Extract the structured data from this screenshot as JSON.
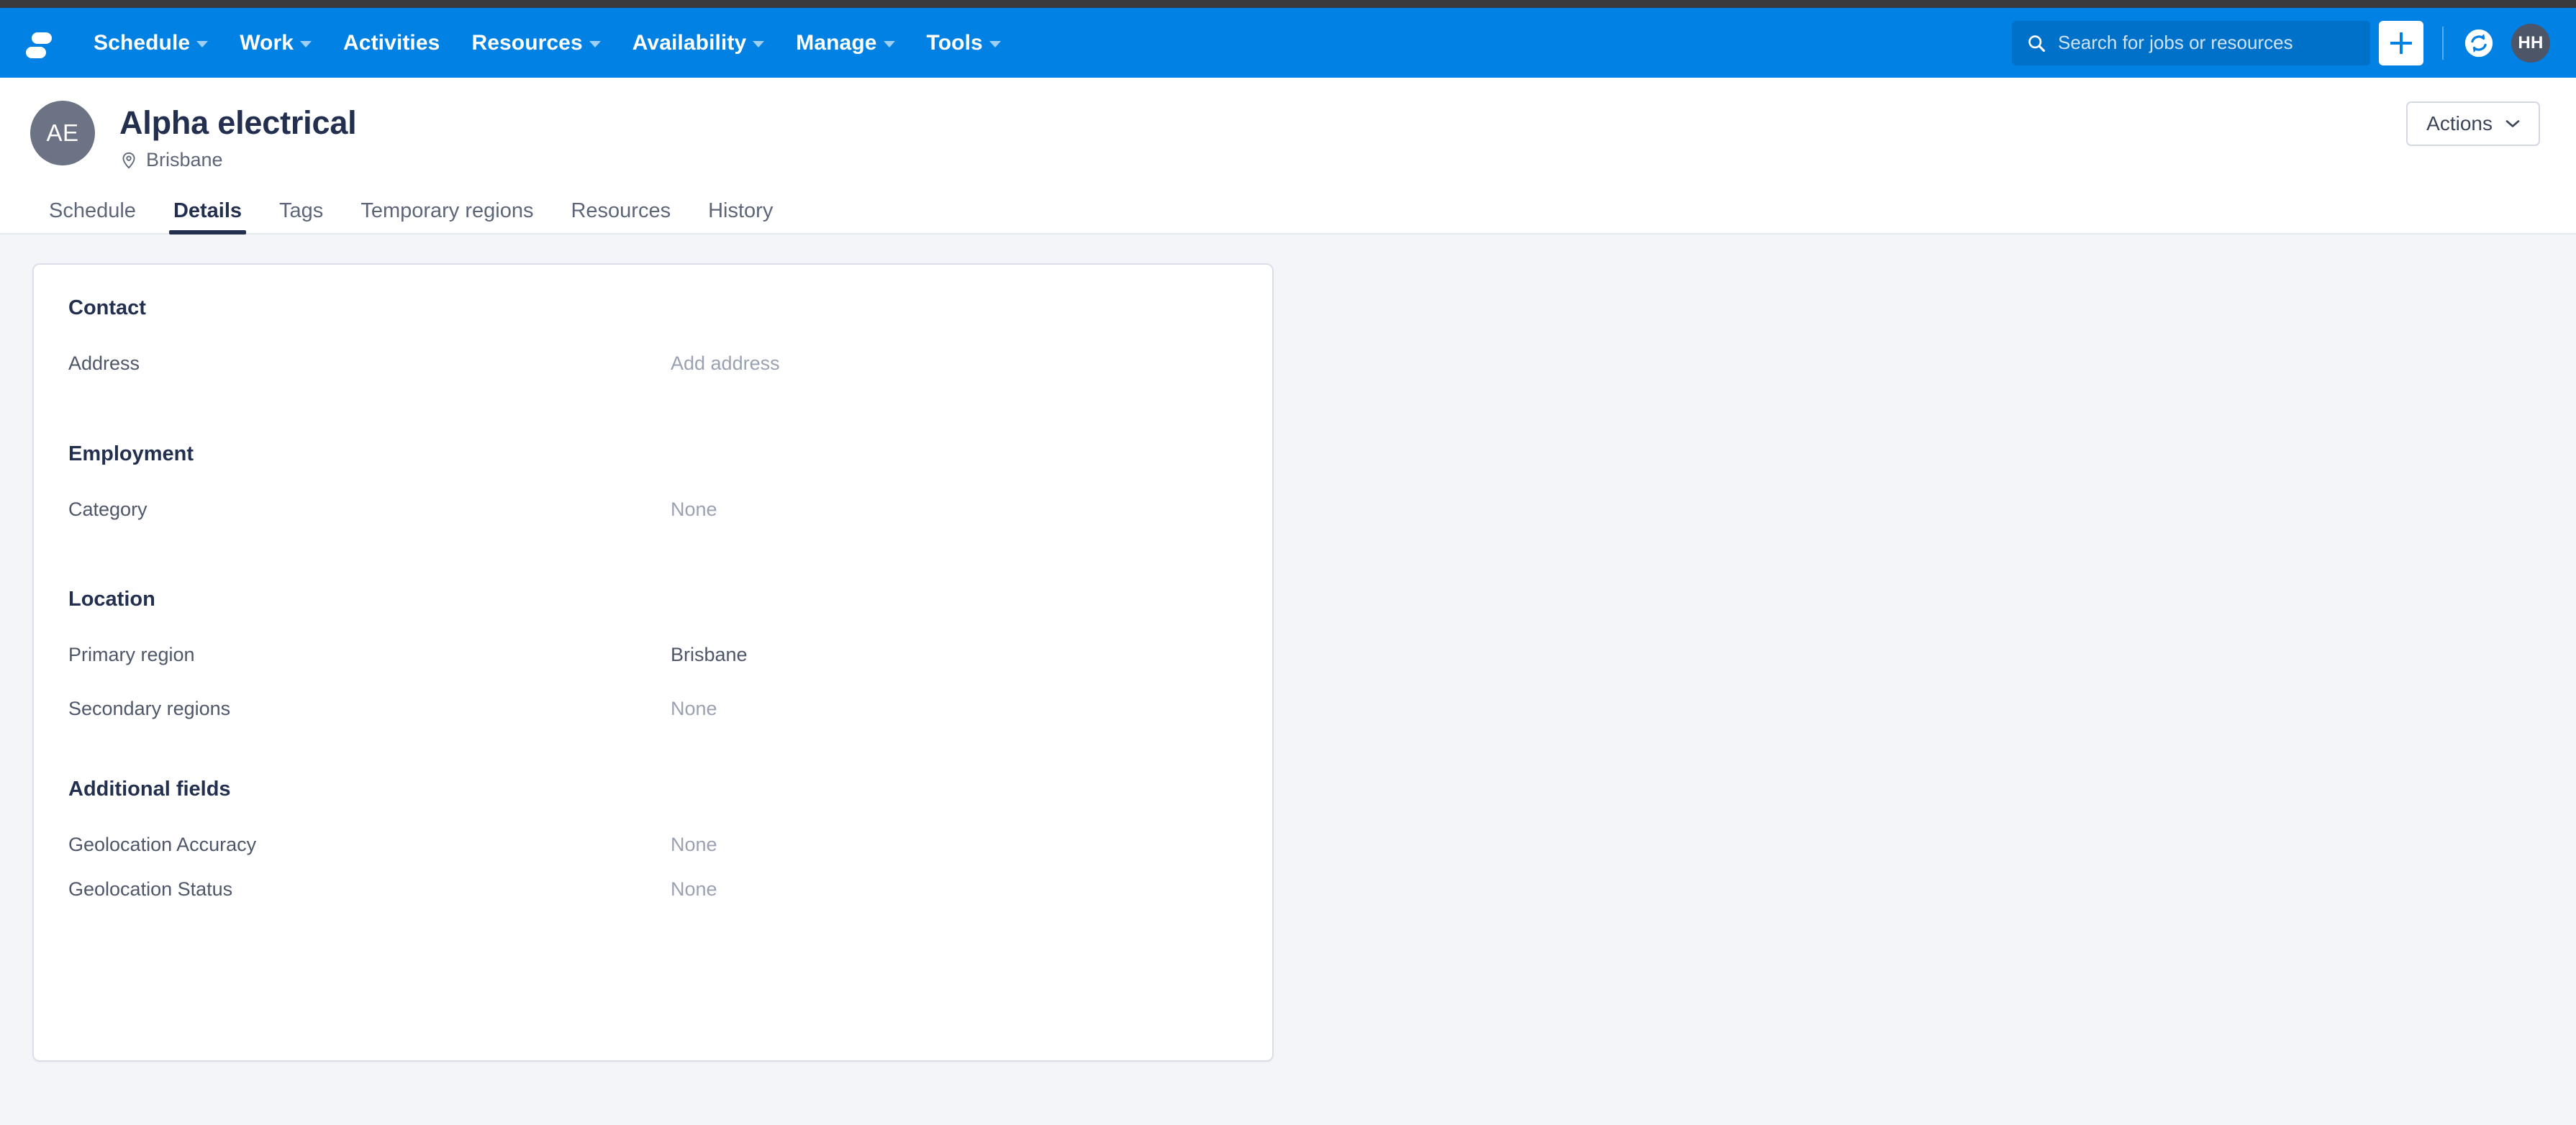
{
  "navbar": {
    "logo_name": "skedulo-logo",
    "menu": [
      {
        "label": "Schedule",
        "has_caret": true
      },
      {
        "label": "Work",
        "has_caret": true
      },
      {
        "label": "Activities",
        "has_caret": false
      },
      {
        "label": "Resources",
        "has_caret": true
      },
      {
        "label": "Availability",
        "has_caret": true
      },
      {
        "label": "Manage",
        "has_caret": true
      },
      {
        "label": "Tools",
        "has_caret": true
      }
    ],
    "search": {
      "placeholder": "Search for jobs or resources",
      "value": ""
    },
    "add_button_label": "+",
    "sync_icon": "sync-icon",
    "avatar_initials": "HH"
  },
  "header": {
    "avatar_initials": "AE",
    "title": "Alpha electrical",
    "location": "Brisbane",
    "actions_label": "Actions"
  },
  "tabs": [
    {
      "label": "Schedule",
      "active": false
    },
    {
      "label": "Details",
      "active": true
    },
    {
      "label": "Tags",
      "active": false
    },
    {
      "label": "Temporary regions",
      "active": false
    },
    {
      "label": "Resources",
      "active": false
    },
    {
      "label": "History",
      "active": false
    }
  ],
  "details": {
    "contact": {
      "title": "Contact",
      "fields": [
        {
          "label": "Address",
          "value": "Add address",
          "muted": true
        }
      ]
    },
    "employment": {
      "title": "Employment",
      "fields": [
        {
          "label": "Category",
          "value": "None",
          "muted": true
        }
      ]
    },
    "location": {
      "title": "Location",
      "fields": [
        {
          "label": "Primary region",
          "value": "Brisbane",
          "muted": false
        },
        {
          "label": "Secondary regions",
          "value": "None",
          "muted": true
        }
      ]
    },
    "additional": {
      "title": "Additional fields",
      "fields": [
        {
          "label": "Geolocation Accuracy",
          "value": "None",
          "muted": true
        },
        {
          "label": "Geolocation Status",
          "value": "None",
          "muted": true
        }
      ]
    }
  },
  "colors": {
    "brand_blue": "#0081e3",
    "search_blue": "#0071c9",
    "page_bg": "#f4f5f8",
    "navy_text": "#232f4e",
    "label_text": "#4e5669",
    "muted_text": "#9aa1b2",
    "avatar_gray": "#6b7384",
    "card_border": "#dcdfe9"
  }
}
